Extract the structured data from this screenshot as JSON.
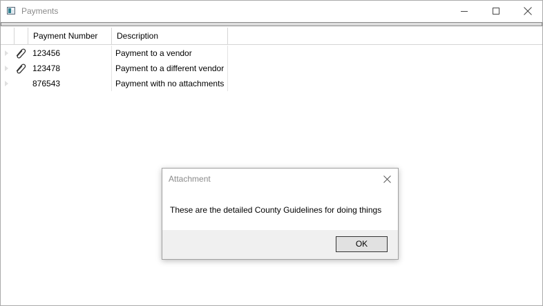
{
  "window": {
    "title": "Payments"
  },
  "grid": {
    "columns": [
      "Payment Number",
      "Description"
    ],
    "rows": [
      {
        "number": "123456",
        "description": "Payment to a vendor",
        "has_attachment": true
      },
      {
        "number": "123478",
        "description": "Payment to a different vendor",
        "has_attachment": true
      },
      {
        "number": "876543",
        "description": "Payment with no attachments",
        "has_attachment": false
      }
    ]
  },
  "dialog": {
    "title": "Attachment",
    "message": "These are the detailed County Guidelines for doing things",
    "ok_label": "OK"
  },
  "icons": {
    "app": "app-window-icon",
    "attachment": "paperclip-icon",
    "expander": "triangle-right-icon"
  },
  "colors": {
    "title_text": "#8a8a8a",
    "grid_line": "#d5d5d5",
    "dialog_footer": "#f0f0f0"
  }
}
